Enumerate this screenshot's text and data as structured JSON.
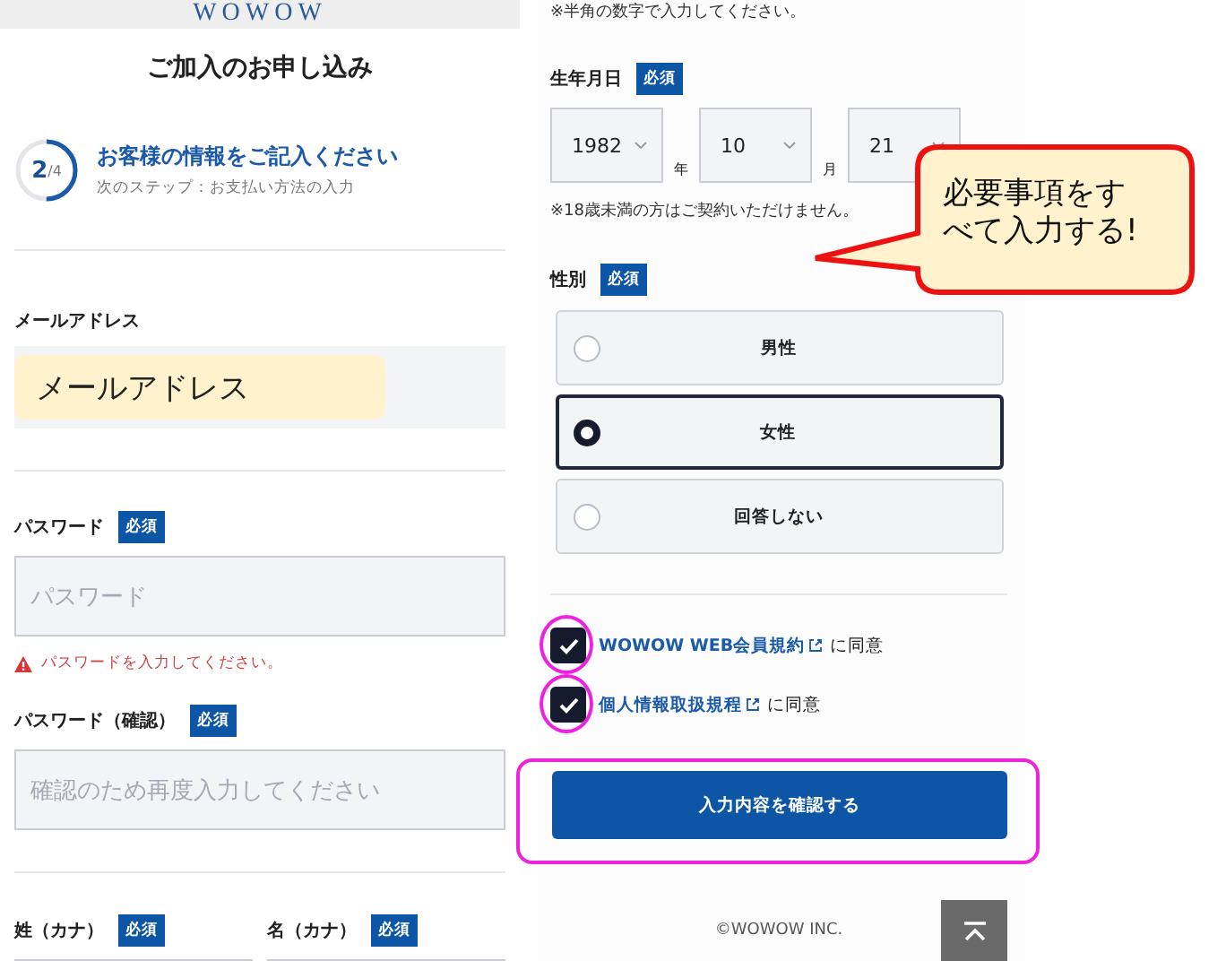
{
  "header": {
    "logo": "WOWOW"
  },
  "page_title": "ご加入のお申し込み",
  "progress": {
    "current": "2",
    "total": "/4",
    "level": 0.5,
    "title": "お客様の情報をご記入ください",
    "next_step": "次のステップ：お支払い方法の入力"
  },
  "email": {
    "label": "メールアドレス",
    "annotation": "メールアドレス"
  },
  "password": {
    "label": "パスワード",
    "badge": "必須",
    "placeholder": "パスワード",
    "error": "パスワードを入力してください。"
  },
  "password_confirm": {
    "label": "パスワード（確認）",
    "badge": "必須",
    "placeholder": "確認のため再度入力してください"
  },
  "name_fields": [
    {
      "label": "姓（カナ）",
      "badge": "必須"
    },
    {
      "label": "名（カナ）",
      "badge": "必須"
    }
  ],
  "top_note": "※半角の数字で入力してください。",
  "birthdate": {
    "label": "生年月日",
    "badge": "必須",
    "selects": [
      {
        "value": "1982",
        "unit": "年"
      },
      {
        "value": "10",
        "unit": "月"
      },
      {
        "value": "21"
      }
    ],
    "note": "※18歳未満の方はご契約いただけません。"
  },
  "gender": {
    "label": "性別",
    "badge": "必須",
    "options": [
      {
        "label": "男性",
        "selected": false
      },
      {
        "label": "女性",
        "selected": true
      },
      {
        "label": "回答しない",
        "selected": false
      }
    ]
  },
  "agreements": [
    {
      "link": "WOWOW WEB会員規約",
      "suffix": "に同意",
      "checked": true,
      "highlighted": true
    },
    {
      "link": "個人情報取扱規程",
      "suffix": "に同意",
      "checked": true,
      "highlighted": true
    }
  ],
  "submit": {
    "label": "入力内容を確認する",
    "highlighted": true
  },
  "footer": {
    "copyright": "©WOWOW INC."
  },
  "callout": {
    "text": "必要事項をすべて入力する!"
  }
}
